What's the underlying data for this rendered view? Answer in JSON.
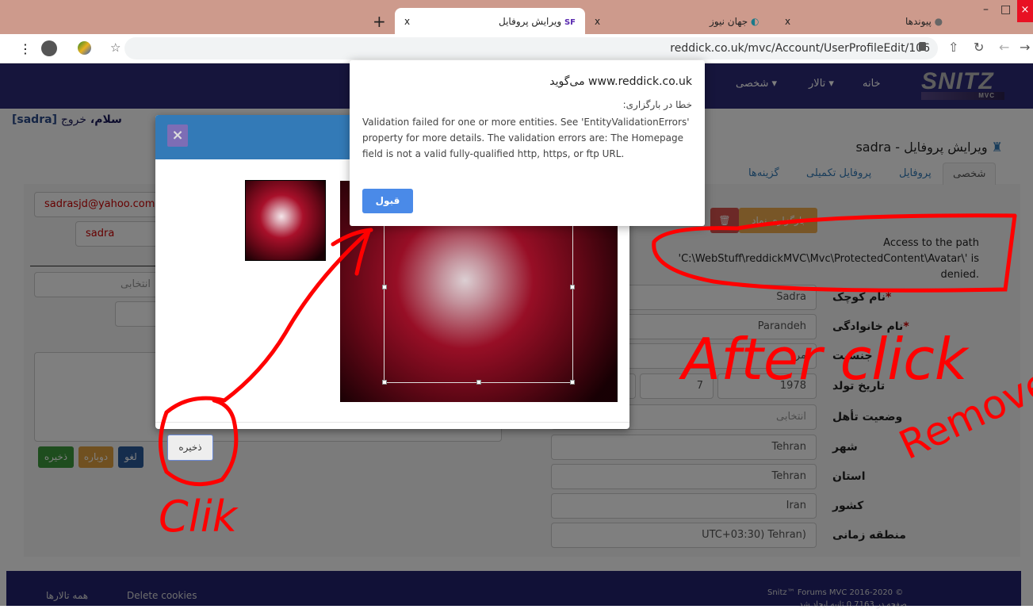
{
  "browser": {
    "tabs": [
      {
        "title": "ویرایش پروفایل",
        "favicon": "SF"
      },
      {
        "title": "جهان نیوز"
      },
      {
        "title": "پیوندها"
      }
    ],
    "new_tab": "+",
    "close": "x",
    "url": "reddick.co.uk/mvc/Account/UserProfileEdit/106"
  },
  "nav": {
    "logo": "SNITZ",
    "logo_sub": "MVC",
    "items": [
      "خانه",
      "تالار ▾",
      "شخصی ▾"
    ]
  },
  "greeting": {
    "hello": "سلام، ",
    "logout": "خروج",
    "user": "[sadra]"
  },
  "page": {
    "title": "ویرایش پروفایل - sadra",
    "tabs": [
      "شخصی",
      "پروفایل",
      "پروفایل تکمیلی",
      "گزینه‌ها"
    ],
    "upload_label": "بارگزاری نماد",
    "error": "Access to the path 'C:\\WebStuff\\reddickMVC\\Mvc\\ProtectedContent\\Avatar\\' is denied.",
    "fields": [
      {
        "label": "نام کوچک",
        "value": "Sadra",
        "required": "*"
      },
      {
        "label": "نام خانوادگی",
        "value": "Parandeh",
        "required": "*"
      },
      {
        "label": "جنسیت",
        "value": "مرد"
      },
      {
        "label": "تاریخ تولد",
        "year": "1978",
        "month": "7"
      },
      {
        "label": "وضعیت تأهل",
        "value": "انتخابی"
      },
      {
        "label": "شهر",
        "value": "Tehran"
      },
      {
        "label": "استان",
        "value": "Tehran"
      },
      {
        "label": "کشور",
        "value": "Iran"
      },
      {
        "label": "منطقه زمانی",
        "value": "UTC+03:30) Tehran)"
      }
    ],
    "left": {
      "email": "sadrasjd@yahoo.com",
      "username": "sadra",
      "select": "انتخابی",
      "buttons": {
        "save": "ذخیره",
        "reset": "دوباره",
        "cancel": "لغو"
      }
    }
  },
  "modal": {
    "close": "×",
    "save": "ذخیره"
  },
  "alert": {
    "origin": "www.reddick.co.uk می‌گوید",
    "subtitle": "خطا در بارگزاری:",
    "message": "Validation failed for one or more entities. See 'EntityValidationErrors' property for more details. The validation errors are: The Homepage field is not a valid fully-qualified http, https, or ftp URL.",
    "ok": "قبول"
  },
  "annotations": {
    "after_click": "After click",
    "remove": "Remove",
    "click": "Clik"
  },
  "footer": {
    "all_forums": "همه تالارها",
    "delete_cookies": "Delete cookies",
    "copyright": "Snitz™ Forums MVC 2016-2020 ©",
    "timing": "صفحه در 0.7163 ثانیه ایجاد شد"
  }
}
